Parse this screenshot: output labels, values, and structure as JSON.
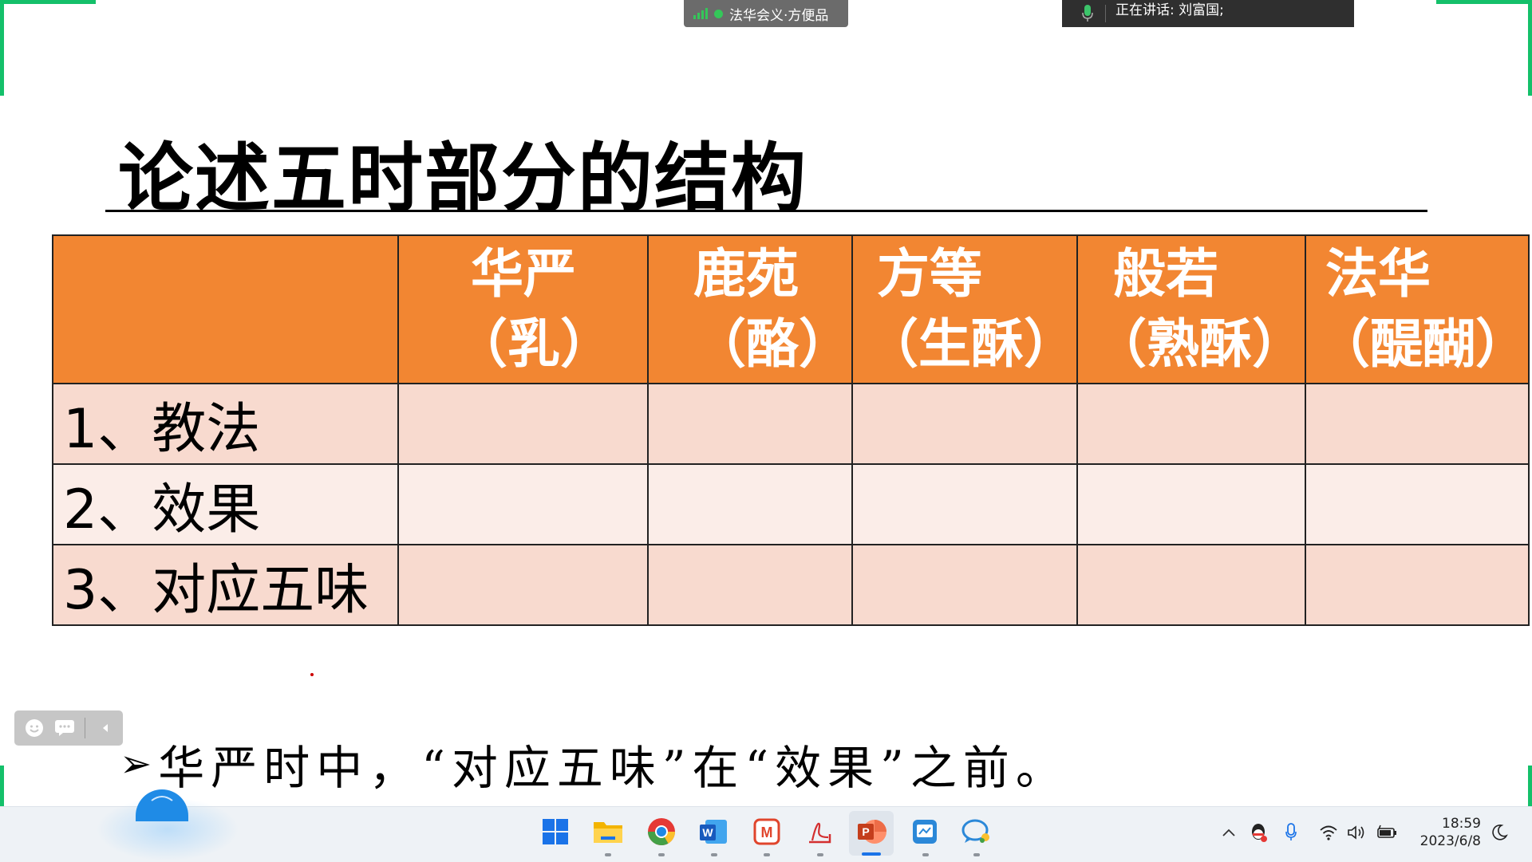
{
  "meeting": {
    "title": "法华会义·方便品",
    "speaking": "正在讲话: 刘富国;"
  },
  "slide": {
    "title": "论述五时部分的结构",
    "table": {
      "headers": [
        {
          "name": "华严",
          "taste": "（乳）"
        },
        {
          "name": "鹿苑",
          "taste": "（酪）"
        },
        {
          "name": "方等",
          "taste": "（生酥）"
        },
        {
          "name": "般若",
          "taste": "（熟酥）"
        },
        {
          "name": "法华",
          "taste": "（醍醐）"
        }
      ],
      "rows": [
        "1、教法",
        "2、效果",
        "3、对应五味"
      ]
    },
    "bullet": "华严时中，“对应五味”在“效果”之前。",
    "bullet_marker": "➢"
  },
  "taskbar": {
    "apps": [
      "start-icon",
      "file-explorer-icon",
      "chrome-icon",
      "word-icon",
      "mindmaster-icon",
      "pdf-reader-icon",
      "powerpoint-icon",
      "whiteboard-icon",
      "chat-app-icon"
    ],
    "tray": [
      "show-hidden-icons-icon",
      "qq-icon",
      "microphone-icon",
      "wifi-icon",
      "volume-icon",
      "battery-icon",
      "focus-moon-icon"
    ],
    "time": "18:59",
    "date": "2023/6/8"
  },
  "colors": {
    "header_orange": "#f28632",
    "row_pink": "#f8dacf",
    "row_light": "#fbede8",
    "frame_green": "#14c06a"
  }
}
